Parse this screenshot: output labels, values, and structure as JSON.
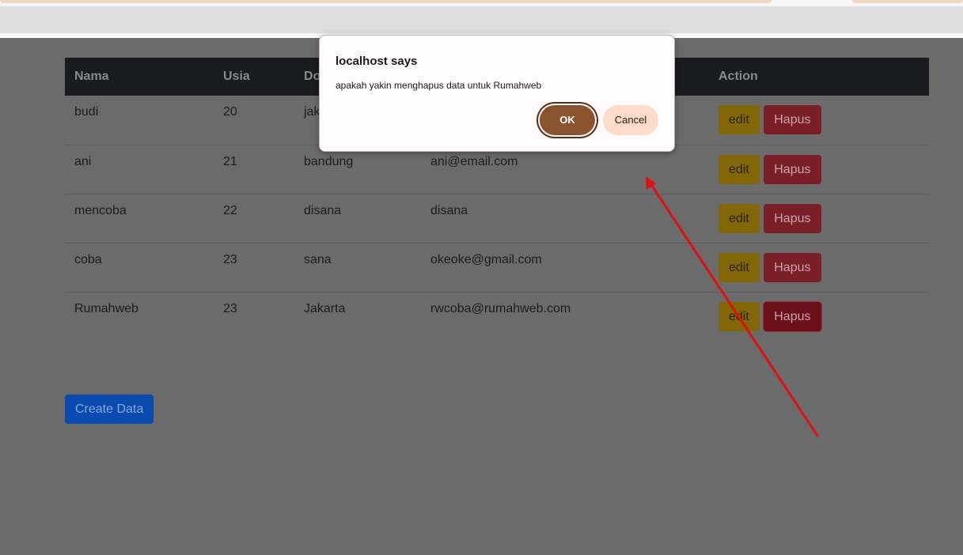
{
  "dialog": {
    "title": "localhost says",
    "message": "apakah yakin menghapus data untuk Rumahweb",
    "ok_label": "OK",
    "cancel_label": "Cancel"
  },
  "table": {
    "headers": [
      "Nama",
      "Usia",
      "Do",
      "",
      "Action"
    ],
    "rows": [
      {
        "nama": "budi",
        "usia": "20",
        "domisili": "jak",
        "email": ""
      },
      {
        "nama": "ani",
        "usia": "21",
        "domisili": "bandung",
        "email": "ani@email.com"
      },
      {
        "nama": "mencoba",
        "usia": "22",
        "domisili": "disana",
        "email": "disana"
      },
      {
        "nama": "coba",
        "usia": "23",
        "domisili": "sana",
        "email": "okeoke@gmail.com"
      },
      {
        "nama": "Rumahweb",
        "usia": "23",
        "domisili": "Jakarta",
        "email": "rwcoba@rumahweb.com"
      }
    ],
    "edit_label": "edit",
    "hapus_label": "Hapus"
  },
  "create_label": "Create Data",
  "colors": {
    "overlay": "#6b6b6b",
    "ok": "#8a542f",
    "cancel": "#ffdcc9",
    "arrow": "#e01010"
  }
}
